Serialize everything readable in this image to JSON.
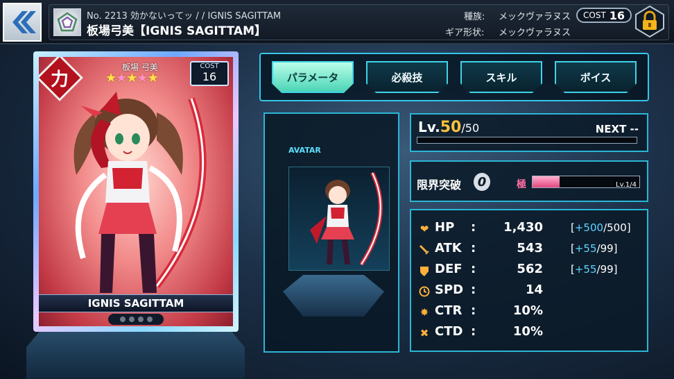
{
  "header": {
    "back_icon": "double-chevron-left-icon",
    "subtitle": "No. 2213 効かないってッ / / IGNIS SAGITTAM",
    "title": "板場弓美【IGNIS SAGITTAM】",
    "type_label": "種族:",
    "type_value": "メックヴァラヌス",
    "gear_label": "ギア形状:",
    "gear_value": "メックヴァラヌス",
    "cost_label": "COST",
    "cost_value": "16",
    "lock_icon": "padlock-icon"
  },
  "card": {
    "attribute": "力",
    "name_jp": "板場 弓美",
    "stars": 5,
    "cost_label": "COST",
    "cost_value": "16",
    "name_en": "IGNIS SAGITTAM",
    "accent_color": "#c23a46"
  },
  "tabs": [
    "パラメータ",
    "必殺技",
    "スキル",
    "ボイス"
  ],
  "active_tab": "パラメータ",
  "avatar": {
    "label": "AVATAR"
  },
  "level": {
    "prefix": "Lv.",
    "current": "50",
    "max": "/50",
    "next_label": "NEXT --",
    "exp_fraction": 0
  },
  "limit_break": {
    "label": "限界突破",
    "count": "0",
    "kiwami_label": "極",
    "kiwami_level": "Lv.1/4",
    "kiwami_fraction": 0.25
  },
  "stats": [
    {
      "icon": "heart-icon",
      "name": "HP",
      "value": "1,430",
      "bonus_open": "[",
      "bonus_plus": "+500",
      "bonus_max": "/500]"
    },
    {
      "icon": "sword-icon",
      "name": "ATK",
      "value": "543",
      "bonus_open": "[",
      "bonus_plus": "+55",
      "bonus_max": "/99]"
    },
    {
      "icon": "shield-icon",
      "name": "DEF",
      "value": "562",
      "bonus_open": "[",
      "bonus_plus": "+55",
      "bonus_max": "/99]"
    },
    {
      "icon": "clock-icon",
      "name": "SPD",
      "value": "14"
    },
    {
      "icon": "burst-icon",
      "name": "CTR",
      "value": "10%"
    },
    {
      "icon": "cross-icon",
      "name": "CTD",
      "value": "10%"
    }
  ],
  "colon": ":"
}
